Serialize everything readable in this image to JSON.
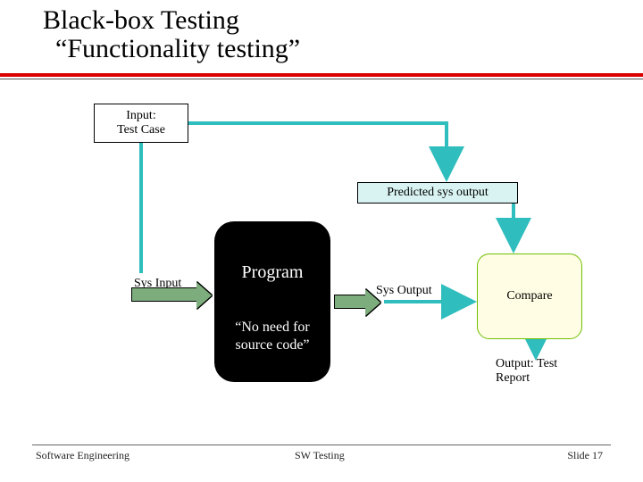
{
  "title": {
    "line1": "Black-box Testing",
    "line2": "“Functionality testing”"
  },
  "nodes": {
    "test_case": "Input:\nTest Case",
    "predicted": "Predicted sys output",
    "program_label": "Program",
    "program_note": "“No need for source code”",
    "sys_input": "Sys Input",
    "sys_output": "Sys Output",
    "compare": "Compare",
    "report": "Output: Test\n Report"
  },
  "footer": {
    "left": "Software Engineering",
    "center": "SW Testing",
    "right": "Slide 17"
  }
}
